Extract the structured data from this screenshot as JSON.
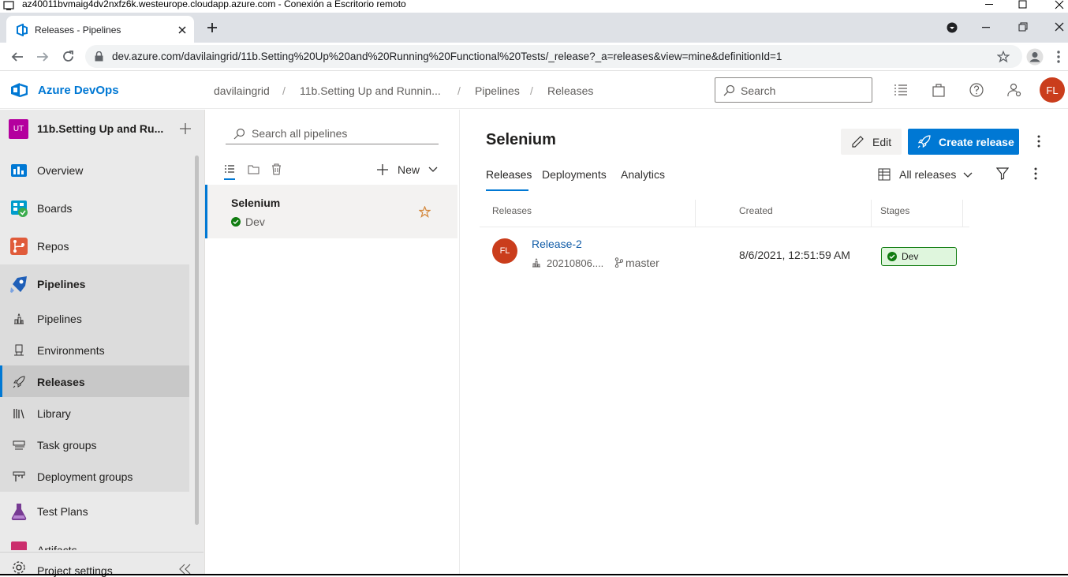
{
  "rdp": {
    "title": "az40011bvmaig4dv2nxfz6k.westeurope.cloudapp.azure.com - Conexión a Escritorio remoto"
  },
  "browser": {
    "tab_title": "Releases - Pipelines",
    "url": "dev.azure.com/davilaingrid/11b.Setting%20Up%20and%20Running%20Functional%20Tests/_release?_a=releases&view=mine&definitionId=1"
  },
  "header": {
    "brand": "Azure DevOps",
    "breadcrumb": [
      "davilaingrid",
      "11b.Setting Up and Runnin...",
      "Pipelines",
      "Releases"
    ],
    "separator": "/",
    "search_placeholder": "Search",
    "user_initials": "FL"
  },
  "sidebar": {
    "project_badge": "UT",
    "project_name": "11b.Setting Up and Ru...",
    "items": [
      {
        "label": "Overview"
      },
      {
        "label": "Boards"
      },
      {
        "label": "Repos"
      },
      {
        "label": "Pipelines"
      },
      {
        "label": "Pipelines"
      },
      {
        "label": "Environments"
      },
      {
        "label": "Releases"
      },
      {
        "label": "Library"
      },
      {
        "label": "Task groups"
      },
      {
        "label": "Deployment groups"
      },
      {
        "label": "Test Plans"
      },
      {
        "label": "Artifacts"
      }
    ],
    "footer_label": "Project settings"
  },
  "pipelines_pane": {
    "search_placeholder": "Search all pipelines",
    "new_label": "New",
    "selected": {
      "name": "Selenium",
      "stage": "Dev"
    }
  },
  "main": {
    "title": "Selenium",
    "edit_label": "Edit",
    "create_label": "Create release",
    "tabs": [
      "Releases",
      "Deployments",
      "Analytics"
    ],
    "filter_label": "All releases",
    "columns": [
      "Releases",
      "Created",
      "Stages"
    ],
    "rows": [
      {
        "initials": "FL",
        "name": "Release-2",
        "build": "20210806....",
        "branch": "master",
        "created": "8/6/2021, 12:51:59 AM",
        "stage": "Dev"
      }
    ]
  },
  "colors": {
    "accent": "#0078d4",
    "avatar": "#ca3d1c",
    "success": "#107c10",
    "project": "#b4009e"
  }
}
